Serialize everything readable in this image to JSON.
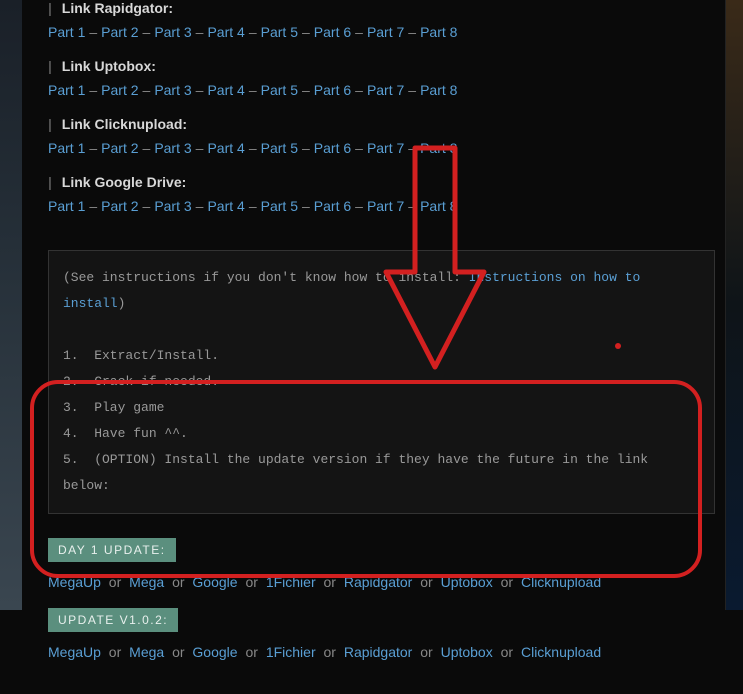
{
  "sections": [
    {
      "title": "Link Rapidgator:",
      "parts": [
        "Part 1",
        "Part 2",
        "Part 3",
        "Part 4",
        "Part 5",
        "Part 6",
        "Part 7",
        "Part 8"
      ]
    },
    {
      "title": "Link Uptobox:",
      "parts": [
        "Part 1",
        "Part 2",
        "Part 3",
        "Part 4",
        "Part 5",
        "Part 6",
        "Part 7",
        "Part 8"
      ]
    },
    {
      "title": "Link Clicknupload:",
      "parts": [
        "Part 1",
        "Part 2",
        "Part 3",
        "Part 4",
        "Part 5",
        "Part 6",
        "Part 7",
        "Part 8"
      ]
    },
    {
      "title": "Link Google Drive:",
      "parts": [
        "Part 1",
        "Part 2",
        "Part 3",
        "Part 4",
        "Part 5",
        "Part 6",
        "Part 7",
        "Part 8"
      ]
    }
  ],
  "instructions": {
    "pre": "(See instructions if you don't know how to install: ",
    "link": "Instructions on how to install",
    "post": ")",
    "steps": [
      "Extract/Install.",
      "Crack if needed.",
      "Play game",
      "Have fun ^^.",
      "(OPTION) Install the update version if they have the future in the link below:"
    ]
  },
  "updates": [
    {
      "label": "DAY 1 UPDATE:",
      "hosts": [
        "MegaUp",
        "Mega",
        "Google",
        "1Fichier",
        "Rapidgator",
        "Uptobox",
        "Clicknupload"
      ]
    },
    {
      "label": "UPDATE V1.0.2:",
      "hosts": [
        "MegaUp",
        "Mega",
        "Google",
        "1Fichier",
        "Rapidgator",
        "Uptobox",
        "Clicknupload"
      ]
    }
  ],
  "sep_dash": "–",
  "sep_or": "or"
}
